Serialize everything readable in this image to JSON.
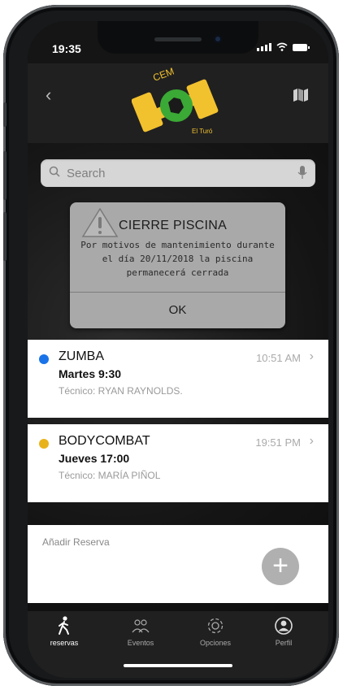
{
  "status_bar": {
    "time": "19:35"
  },
  "header": {
    "logo_text_top": "CEM",
    "logo_text_bottom": "El Turó",
    "back_icon": "chevron-left-icon",
    "map_icon": "map-icon"
  },
  "search": {
    "placeholder": "Search"
  },
  "alert": {
    "title": "CIERRE PISCINA",
    "message": "Por motivos de mantenimiento durante el día 20/11/2018 la piscina permanecerá cerrada",
    "ok_label": "OK"
  },
  "reservations": [
    {
      "class": "ZUMBA",
      "when": "Martes 9:30",
      "trainer": "Técnico: RYAN RAYNOLDS.",
      "time": "10:51 AM",
      "color": "#1a73e8"
    },
    {
      "class": "BODYCOMBAT",
      "when": "Jueves 17:00",
      "trainer": "Técnico: MARÍA PIÑOL",
      "time": "19:51 PM",
      "color": "#e8b31a"
    }
  ],
  "add_reservation": {
    "label": "Añadir Reserva",
    "button": "+"
  },
  "tabs": [
    {
      "label": "reservas",
      "icon": "walking-icon",
      "active": true
    },
    {
      "label": "Eventos",
      "icon": "group-icon",
      "active": false
    },
    {
      "label": "Opciones",
      "icon": "gear-icon",
      "active": false
    },
    {
      "label": "Perfil",
      "icon": "profile-icon",
      "active": false
    }
  ],
  "colors": {
    "accent_logo": "#f2c12e",
    "logo_green": "#3aa935"
  }
}
